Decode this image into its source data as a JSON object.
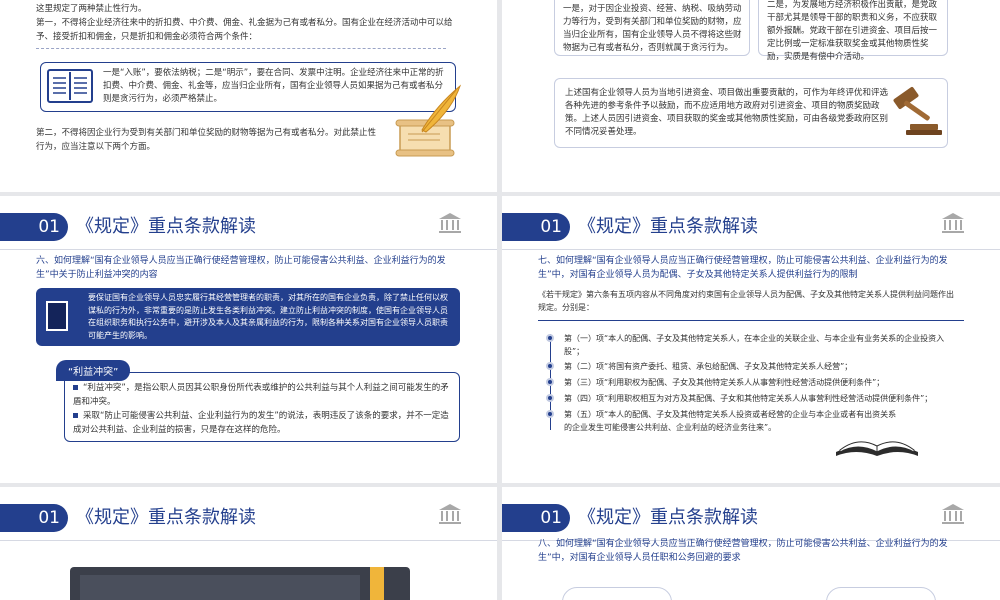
{
  "header_number": "01",
  "header_title": "《规定》重点条款解读",
  "slide1": {
    "line1": "这里规定了两种禁止性行为。",
    "para1": "第一，不得将企业经济往来中的折扣费、中介费、佣金、礼金据为己有或者私分。国有企业在经济活动中可以给予、接受折扣和佣金，只是折扣和佣金必须符合两个条件：",
    "box_text": "一是“入账”，要依法纳税；二是“明示”，要在合同、发票中注明。企业经济往来中正常的折扣费、中介费、佣金、礼金等，应当归企业所有，国有企业领导人员如果据为己有或者私分则是贪污行为，必须严格禁止。",
    "para2": "第二，不得将因企业行为受到有关部门和单位奖励的财物等据为己有或者私分。对此禁止性行为，应当注意以下两个方面。"
  },
  "slide2": {
    "left_text": "一是，对于因企业投资、经营、纳税、吸纳劳动力等行为，受到有关部门和单位奖励的财物，应当归企业所有，国有企业领导人员不得将这些财物据为己有或者私分，否则就属于贪污行为。",
    "right_text": "二是，为发展地方经济积极作出贡献，是党政干部尤其是领导干部的职责和义务，不应获取额外报酬。党政干部在引进资金、项目后按一定比例或一定标准获取奖金或其他物质性奖励，实质是有偿中介活动。",
    "bottom_text": "上述国有企业领导人员为当地引进资金、项目做出重要贡献的，可作为年终评优和评选各种先进的参考条件予以鼓励，而不应适用地方政府对引进资金、项目的物质奖励政策。上述人员因引进资金、项目获取的奖金或其他物质性奖励，可由各级党委政府区别不同情况妥善处理。"
  },
  "slide3": {
    "subtitle": "六、如何理解“国有企业领导人员应当正确行使经营管理权，防止可能侵害公共利益、企业利益行为的发生”中关于防止利益冲突的内容",
    "dark_text": "要保证国有企业领导人员忠实履行其经营管理者的职责，对其所在的国有企业负责，除了禁止任何以权谋私的行为外，非常重要的是防止发生各类利益冲突。建立防止利益冲突的制度，使国有企业领导人员在组织职务和执行公务中，避开涉及本人及其亲属利益的行为，限制各种关系对国有企业领导人员职责可能产生的影响。",
    "tag": "“利益冲突”",
    "bullet1": "“利益冲突”，是指公职人员因其公职身份所代表或维护的公共利益与其个人利益之间可能发生的矛盾和冲突。",
    "bullet2": "采取“防止可能侵害公共利益、企业利益行为的发生”的说法，表明违反了该条的要求，并不一定造成对公共利益、企业利益的损害，只是存在这样的危险。"
  },
  "slide4": {
    "subtitle": "七、如何理解“国有企业领导人员应当正确行使经营管理权，防止可能侵害公共利益、企业利益行为的发生”中，对国有企业领导人员为配偶、子女及其他特定关系人提供利益行为的限制",
    "intro": "《若干规定》第六条有五项内容从不同角度对约束国有企业领导人员为配偶、子女及其他特定关系人提供利益问题作出规定。分别是：",
    "items": [
      "第（一）项“本人的配偶、子女及其他特定关系人，在本企业的关联企业、与本企业有业务关系的企业投资入股”；",
      "第（二）项“将国有资产委托、租赁、承包给配偶、子女及其他特定关系人经营”；",
      "第（三）项“利用职权为配偶、子女及其他特定关系人从事营利性经营活动提供便利条件”；",
      "第（四）项“利用职权相互为对方及其配偶、子女和其他特定关系人从事营利性经营活动提供便利条件”；",
      "第（五）项“本人的配偶、子女及其他特定关系人投资或者经营的企业与本企业或者有出资关系的企业发生可能侵害公共利益、企业利益的经济业务往来”。"
    ]
  },
  "slide6": {
    "subtitle": "八、如何理解“国有企业领导人员应当正确行使经营管理权，防止可能侵害公共利益、企业利益行为的发生”中，对国有企业领导人员任职和公务回避的要求"
  },
  "colors": {
    "primary": "#233f8d",
    "accent": "#f0b53a"
  }
}
